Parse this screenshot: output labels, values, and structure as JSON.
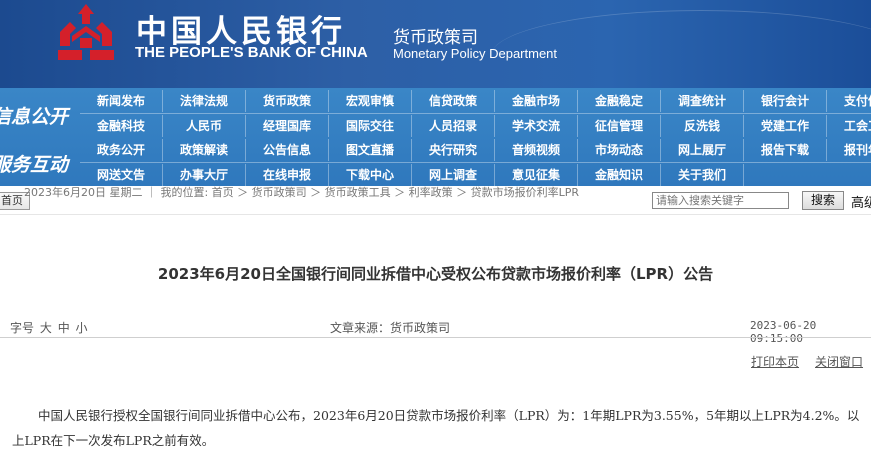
{
  "header": {
    "cn_title": "中国人民银行",
    "en_title": "THE PEOPLE'S BANK OF CHINA",
    "dept_cn": "货币政策司",
    "dept_en": "Monetary Policy Department",
    "logo_color": "#d4202a"
  },
  "nav": {
    "section1": "信息公开",
    "section2": "服务互动",
    "rows": [
      [
        "新闻发布",
        "法律法规",
        "货币政策",
        "宏观审慎",
        "信贷政策",
        "金融市场",
        "金融稳定",
        "调查统计",
        "银行会计",
        "支付体系"
      ],
      [
        "金融科技",
        "人民币",
        "经理国库",
        "国际交往",
        "人员招录",
        "学术交流",
        "征信管理",
        "反洗钱",
        "党建工作",
        "工会工作"
      ],
      [
        "政务公开",
        "政策解读",
        "公告信息",
        "图文直播",
        "央行研究",
        "音频视频",
        "市场动态",
        "网上展厅",
        "报告下载",
        "报刊年鉴"
      ],
      [
        "网送文告",
        "办事大厅",
        "在线申报",
        "下载中心",
        "网上调查",
        "意见征集",
        "金融知识",
        "关于我们",
        "",
        ""
      ]
    ]
  },
  "breadcrumb": {
    "home_label": "首页",
    "text": "2023年6月20日 星期二 ｜ 我的位置: 首页 ＞ 货币政策司 ＞ 货币政策工具 ＞ 利率政策 ＞ 贷款市场报价利率LPR"
  },
  "search": {
    "placeholder": "请输入搜索关键字",
    "button_label": "搜索",
    "advanced_label": "高级搜索"
  },
  "article": {
    "title": "2023年6月20日全国银行间同业拆借中心受权公布贷款市场报价利率（LPR）公告",
    "fontsize_label": "字号",
    "fontsize_large": "大",
    "fontsize_medium": "中",
    "fontsize_small": "小",
    "source": "文章来源：货币政策司",
    "date": "2023-06-20 09:15:00",
    "print_label": "打印本页",
    "close_label": "关闭窗口",
    "body": "中国人民银行授权全国银行间同业拆借中心公布，2023年6月20日贷款市场报价利率（LPR）为：1年期LPR为3.55%，5年期以上LPR为4.2%。以上LPR在下一次发布LPR之前有效。"
  }
}
